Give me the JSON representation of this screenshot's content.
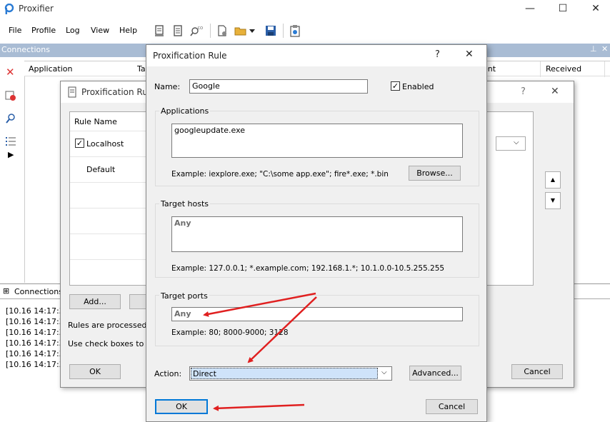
{
  "main": {
    "title": "Proxifier",
    "menu": [
      "File",
      "Profile",
      "Log",
      "View",
      "Help"
    ],
    "connections_label": "Connections",
    "columns": [
      "Application",
      "Ta",
      "ent",
      "Received"
    ],
    "bottom_tab": "Connections",
    "log_lines": [
      "[10.16 14:17:37",
      "[10.16 14:17:37",
      "[10.16 14:17:37",
      "[10.16 14:17:37",
      "[10.16 14:17:37",
      "[10.16 14:17:37"
    ],
    "window_buttons": {
      "minimize": "—",
      "maximize": "☐",
      "close": "✕"
    }
  },
  "back_dialog": {
    "title": "Proxification Rule",
    "help": "?",
    "close": "✕",
    "list_header": "Rule Name",
    "rules": [
      {
        "name": "Localhost",
        "checked": true
      },
      {
        "name": "Default",
        "checked": false
      }
    ],
    "add_label": "Add...",
    "info1": "Rules are processed fr",
    "info2": "Use check boxes to ena",
    "ok_label": "OK",
    "cancel_label": "Cancel",
    "up": "▲",
    "down": "▼"
  },
  "dialog": {
    "title": "Proxification Rule",
    "help": "?",
    "close": "✕",
    "name_label": "Name:",
    "name_value": "Google",
    "enabled_label": "Enabled",
    "enabled_checked": true,
    "applications_label": "Applications",
    "applications_value": "googleupdate.exe",
    "applications_hint": "Example: iexplore.exe; \"C:\\some app.exe\"; fire*.exe; *.bin",
    "browse_label": "Browse...",
    "target_hosts_label": "Target hosts",
    "target_hosts_value": "Any",
    "target_hosts_hint": "Example: 127.0.0.1; *.example.com; 192.168.1.*; 10.1.0.0-10.5.255.255",
    "target_ports_label": "Target ports",
    "target_ports_value": "Any",
    "target_ports_hint": "Example: 80; 8000-9000; 3128",
    "action_label": "Action:",
    "action_value": "Direct",
    "advanced_label": "Advanced...",
    "ok_label": "OK",
    "cancel_label": "Cancel"
  },
  "colors": {
    "annotation_arrow": "#e02020",
    "header_bar": "#a9bcd4",
    "ok_border": "#0078d7"
  }
}
